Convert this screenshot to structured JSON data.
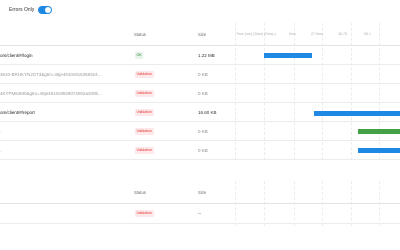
{
  "toolbar": {
    "filter_label": "Errors Only",
    "errors_only": true
  },
  "headers": {
    "status": "Status",
    "size": "Size"
  },
  "timeline_ticks": [
    "Time (ms) (Start) (Resp.)",
    "0ms",
    "27.5ms",
    "36.75",
    "55.1"
  ],
  "rows": [
    {
      "name": "om/client/#/login",
      "status": "OK",
      "size": "1.22 MB",
      "muted": false
    },
    {
      "name": "3610-BRHKYNJGT3&gtm=45je4610v915358324...",
      "status": "Validation",
      "size": "0 KB",
      "muted": true
    },
    {
      "name": "4KYPM64M0&gtm=45je4610v8929074052a200b...",
      "status": "Validation",
      "size": "0 KB",
      "muted": true
    },
    {
      "name": "om/client/#/report",
      "status": "Validation",
      "size": "16.60 KB",
      "muted": false
    },
    {
      "name": ".",
      "status": "Validation",
      "size": "0 KB",
      "muted": true
    },
    {
      "name": ".",
      "status": "Validation",
      "size": "0 KB",
      "muted": true
    }
  ],
  "second_table": {
    "headers": {
      "status": "Status",
      "size": "Size"
    },
    "rows": [
      {
        "name": "",
        "status": "Validation",
        "size": "--"
      }
    ]
  },
  "colors": {
    "accent": "#1e88e5",
    "ok": "#2e7d32",
    "validation": "#e53935",
    "bar_blue": "#1e88e5",
    "bar_green": "#43a047"
  }
}
